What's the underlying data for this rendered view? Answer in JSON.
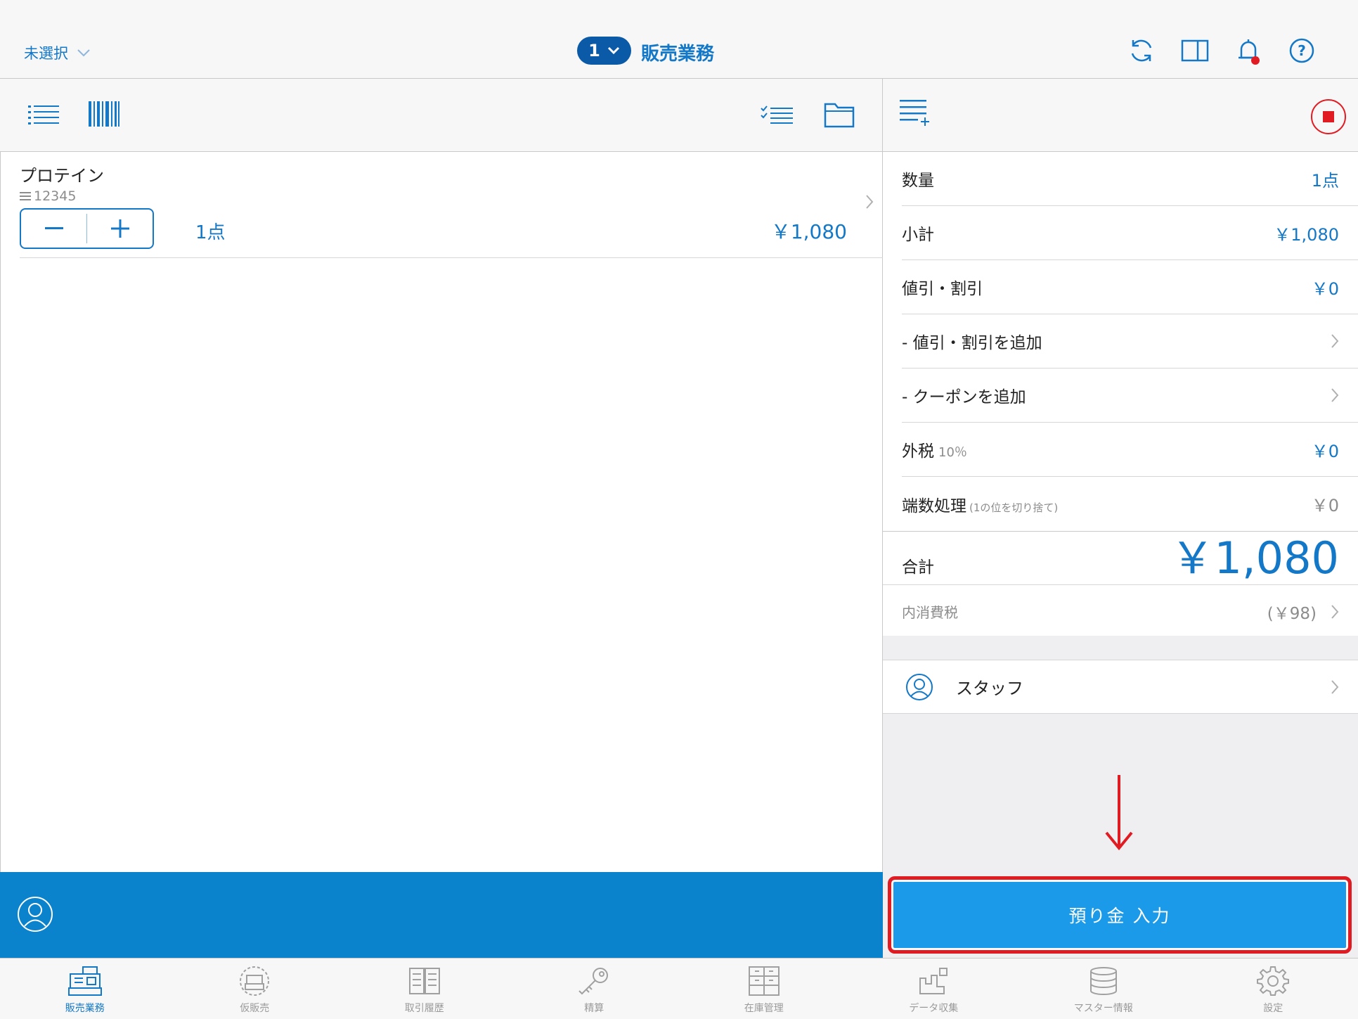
{
  "header": {
    "store_select": "未選択",
    "register_number": "1",
    "title": "販売業務"
  },
  "item": {
    "name": "プロテイン",
    "code": "12345",
    "qty": "1点",
    "price": "￥1,080"
  },
  "summary": {
    "quantity_label": "数量",
    "quantity_value": "1点",
    "subtotal_label": "小計",
    "subtotal_value": "￥1,080",
    "discount_label": "値引・割引",
    "discount_value": "￥0",
    "add_discount_label": "- 値引・割引を追加",
    "add_coupon_label": "- クーポンを追加",
    "external_tax_label": "外税",
    "external_tax_rate": "10％",
    "external_tax_value": "￥0",
    "rounding_label": "端数処理",
    "rounding_note": "(1の位を切り捨て)",
    "rounding_value": "￥0",
    "total_label": "合計",
    "total_value": "￥1,080",
    "internal_tax_label": "内消費税",
    "internal_tax_value": "(￥98)"
  },
  "staff": {
    "label": "スタッフ"
  },
  "action": {
    "deposit_label": "預り金 入力"
  },
  "tabs": [
    {
      "label": "販売業務",
      "icon": "register-icon",
      "active": true
    },
    {
      "label": "仮販売",
      "icon": "temp-register-icon",
      "active": false
    },
    {
      "label": "取引履歴",
      "icon": "history-icon",
      "active": false
    },
    {
      "label": "精算",
      "icon": "key-icon",
      "active": false
    },
    {
      "label": "在庫管理",
      "icon": "inventory-icon",
      "active": false
    },
    {
      "label": "データ収集",
      "icon": "data-collect-icon",
      "active": false
    },
    {
      "label": "マスター情報",
      "icon": "database-icon",
      "active": false
    },
    {
      "label": "設定",
      "icon": "gear-icon",
      "active": false
    }
  ],
  "colors": {
    "accent": "#1478c8",
    "action_bar": "#0a82cc",
    "deposit_button": "#1a9ae8",
    "highlight": "#e11b22"
  }
}
